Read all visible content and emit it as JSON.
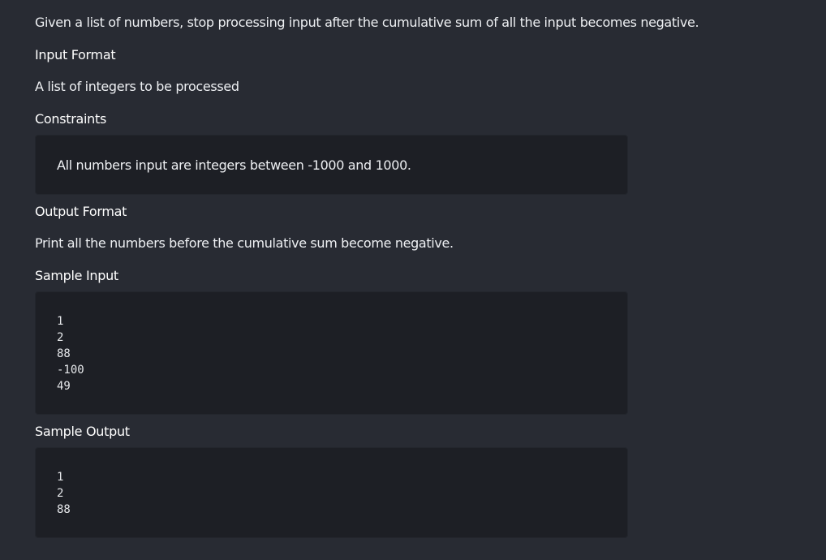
{
  "description": "Given a list of numbers, stop processing input after the cumulative sum of all the input becomes negative.",
  "input_format": {
    "heading": "Input Format",
    "text": "A list of integers to be processed"
  },
  "constraints": {
    "heading": "Constraints",
    "text": "All numbers input are integers between -1000 and 1000."
  },
  "output_format": {
    "heading": "Output Format",
    "text": "Print all the numbers before the cumulative sum become negative."
  },
  "sample_input": {
    "heading": "Sample Input",
    "lines": [
      "1",
      "2",
      "88",
      "-100",
      "49"
    ]
  },
  "sample_output": {
    "heading": "Sample Output",
    "lines": [
      "1",
      "2",
      "88"
    ]
  }
}
